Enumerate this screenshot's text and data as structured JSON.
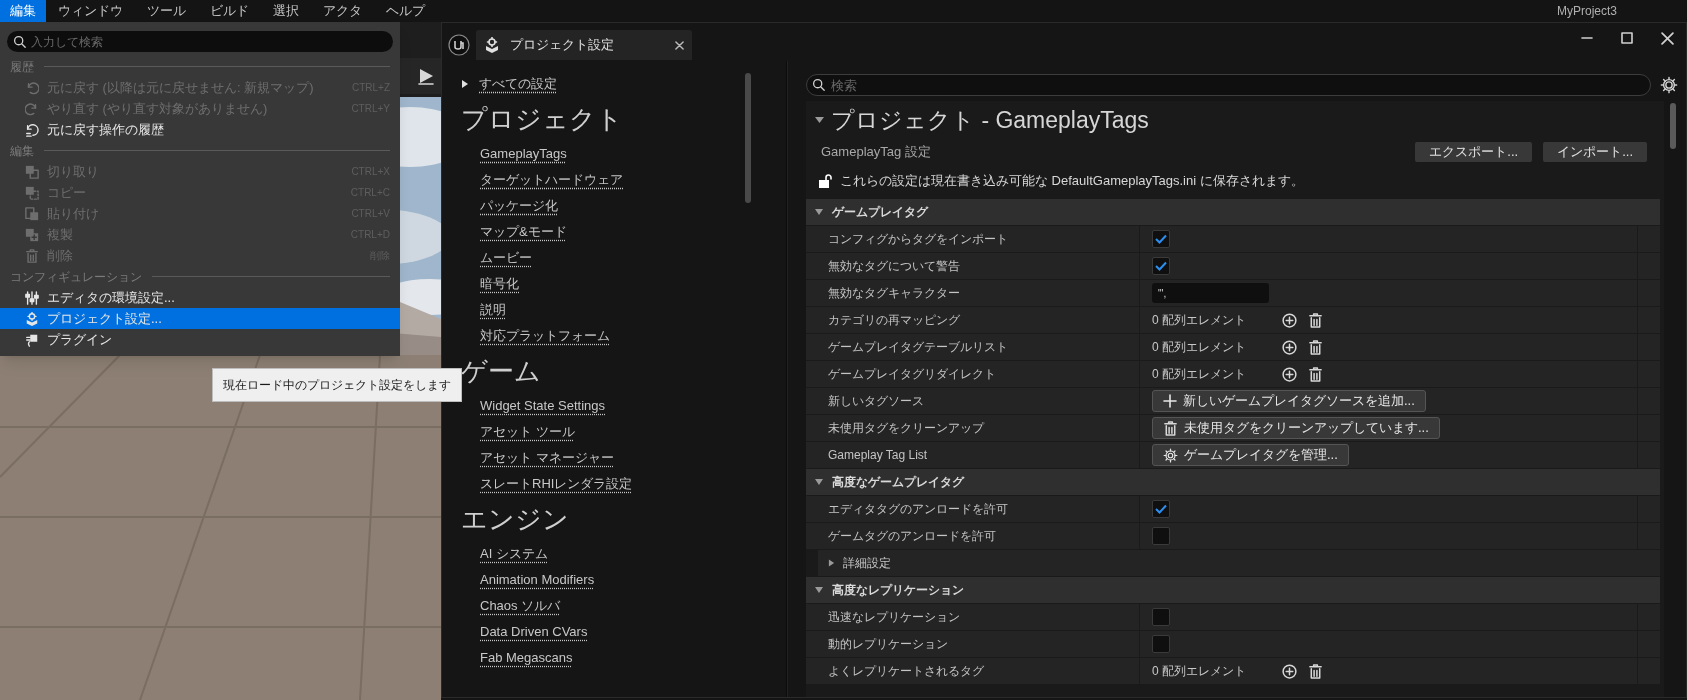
{
  "menu_bar": {
    "items": [
      {
        "label": "編集",
        "selected": true
      },
      {
        "label": "ウィンドウ",
        "selected": false
      },
      {
        "label": "ツール",
        "selected": false
      },
      {
        "label": "ビルド",
        "selected": false
      },
      {
        "label": "選択",
        "selected": false
      },
      {
        "label": "アクタ",
        "selected": false
      },
      {
        "label": "ヘルプ",
        "selected": false
      }
    ],
    "project_name": "MyProject3"
  },
  "edit_menu": {
    "search": {
      "placeholder": "入力して検索"
    },
    "sections": [
      {
        "title": "履歴",
        "items": [
          {
            "kind": "undo",
            "label": "元に戻す (以降は元に戻せません: 新規マップ)",
            "shortcut": "CTRL+Z",
            "disabled": true,
            "selected": false
          },
          {
            "kind": "redo",
            "label": "やり直す (やり直す対象がありません)",
            "shortcut": "CTRL+Y",
            "disabled": true,
            "selected": false
          },
          {
            "kind": "history",
            "label": "元に戻す操作の履歴",
            "disabled": false,
            "selected": false
          }
        ]
      },
      {
        "title": "編集",
        "items": [
          {
            "kind": "cut",
            "label": "切り取り",
            "shortcut": "CTRL+X",
            "disabled": true,
            "selected": false
          },
          {
            "kind": "copy",
            "label": "コピー",
            "shortcut": "CTRL+C",
            "disabled": true,
            "selected": false
          },
          {
            "kind": "paste",
            "label": "貼り付け",
            "shortcut": "CTRL+V",
            "disabled": true,
            "selected": false
          },
          {
            "kind": "duplicate",
            "label": "複製",
            "shortcut": "CTRL+D",
            "disabled": true,
            "selected": false
          },
          {
            "kind": "delete",
            "label": "削除",
            "shortcut": "削除",
            "disabled": true,
            "selected": false
          }
        ]
      },
      {
        "title": "コンフィギュレーション",
        "items": [
          {
            "kind": "preferences",
            "label": "エディタの環境設定...",
            "disabled": false,
            "selected": false
          },
          {
            "kind": "project",
            "label": "プロジェクト設定...",
            "disabled": false,
            "selected": true
          },
          {
            "kind": "plugin",
            "label": "プラグイン",
            "disabled": false,
            "selected": false
          }
        ]
      }
    ]
  },
  "tooltip": "現在ロード中のプロジェクト設定をします",
  "settings_window": {
    "tab": {
      "title": "プロジェクト設定"
    },
    "nav": {
      "all_settings": "すべての設定",
      "groups": [
        {
          "title": "プロジェクト",
          "items": [
            "GameplayTags",
            "ターゲットハードウェア",
            "パッケージ化",
            "マップ&モード",
            "ムービー",
            "暗号化",
            "説明",
            "対応プラットフォーム"
          ]
        },
        {
          "title": "ゲーム",
          "items": [
            "Widget State Settings",
            "アセット ツール",
            "アセット マネージャー",
            "スレートRHIレンダラ設定"
          ]
        },
        {
          "title": "エンジン",
          "items": [
            "AI システム",
            "Animation Modifiers",
            "Chaos ソルバ",
            "Data Driven CVars",
            "Fab Megascans"
          ]
        }
      ]
    },
    "search": {
      "placeholder": "検索"
    },
    "title": "プロジェクト - GameplayTags",
    "subtitle": "GameplayTag 設定",
    "buttons": [
      "エクスポート...",
      "インポート..."
    ],
    "notice": "これらの設定は現在書き込み可能な DefaultGameplayTags.ini に保存されます。",
    "sections": [
      {
        "title": "ゲームプレイタグ",
        "expanded": true,
        "rows": [
          {
            "kind": "checkbox",
            "label": "コンフィグからタグをインポート",
            "checked": true
          },
          {
            "kind": "checkbox",
            "label": "無効なタグについて警告",
            "checked": true
          },
          {
            "kind": "text",
            "label": "無効なタグキャラクター",
            "value": "\"',"
          },
          {
            "kind": "array",
            "label": "カテゴリの再マッピング",
            "value": "0 配列エレメント"
          },
          {
            "kind": "array",
            "label": "ゲームプレイタグテーブルリスト",
            "value": "0 配列エレメント"
          },
          {
            "kind": "array",
            "label": "ゲームプレイタグリダイレクト",
            "value": "0 配列エレメント"
          },
          {
            "kind": "add",
            "label": "新しいタグソース",
            "button": "新しいゲームプレイタグソースを追加..."
          },
          {
            "kind": "cleanup",
            "label": "未使用タグをクリーンアップ",
            "button": "未使用タグをクリーンアップしています..."
          },
          {
            "kind": "manage",
            "label": "Gameplay Tag List",
            "button": "ゲームプレイタグを管理..."
          }
        ]
      },
      {
        "title": "高度なゲームプレイタグ",
        "expanded": true,
        "rows": [
          {
            "kind": "checkbox",
            "label": "エディタタグのアンロードを許可",
            "checked": true
          },
          {
            "kind": "checkbox",
            "label": "ゲームタグのアンロードを許可",
            "checked": false
          },
          {
            "kind": "group",
            "label": "詳細設定",
            "expanded": false
          }
        ]
      },
      {
        "title": "高度なレプリケーション",
        "expanded": true,
        "rows": [
          {
            "kind": "checkbox",
            "label": "迅速なレプリケーション",
            "checked": false
          },
          {
            "kind": "checkbox",
            "label": "動的レプリケーション",
            "checked": false
          },
          {
            "kind": "array",
            "label": "よくレプリケートされるタグ",
            "value": "0 配列エレメント"
          }
        ]
      }
    ]
  }
}
